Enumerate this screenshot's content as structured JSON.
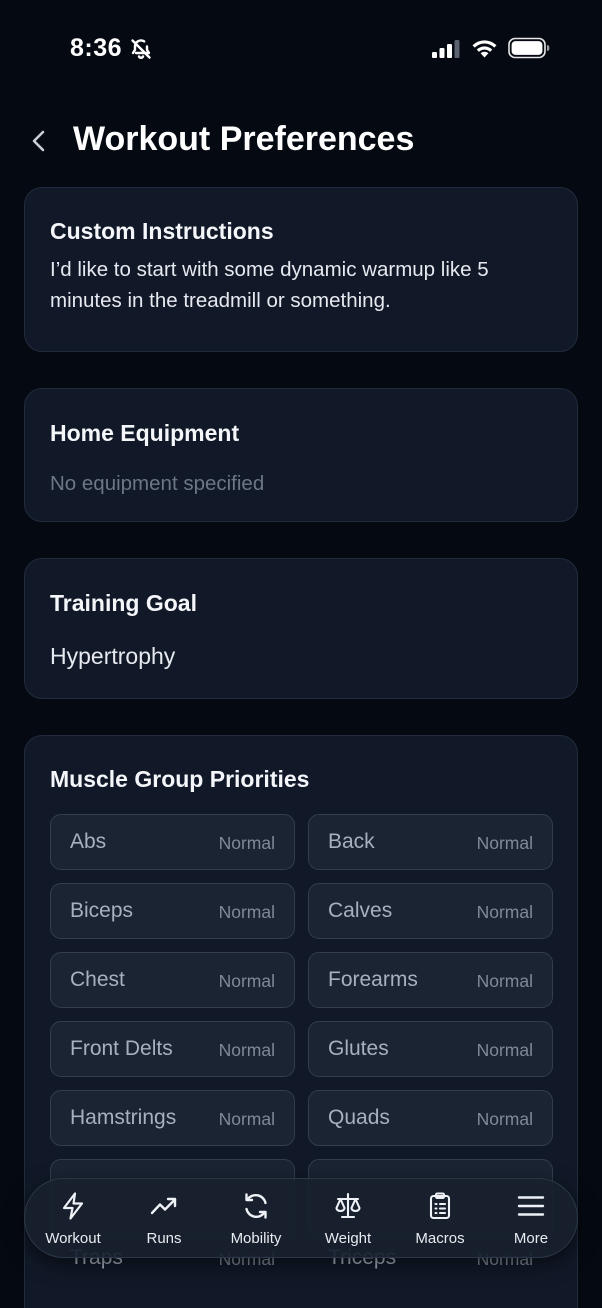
{
  "status_bar": {
    "time": "8:36",
    "icons": [
      "bell-slash-icon",
      "signal-icon",
      "wifi-icon",
      "battery-icon"
    ]
  },
  "header": {
    "back_icon": "chevron-left-icon",
    "title": "Workout Preferences"
  },
  "custom_instructions": {
    "title": "Custom Instructions",
    "text": "I’d like to start with some dynamic warmup like 5 minutes in the treadmill or something."
  },
  "home_equipment": {
    "title": "Home Equipment",
    "placeholder": "No equipment specified"
  },
  "training_goal": {
    "title": "Training Goal",
    "value": "Hypertrophy"
  },
  "muscle_priorities": {
    "title": "Muscle Group Priorities",
    "groups": [
      {
        "name": "Abs",
        "level": "Normal"
      },
      {
        "name": "Back",
        "level": "Normal"
      },
      {
        "name": "Biceps",
        "level": "Normal"
      },
      {
        "name": "Calves",
        "level": "Normal"
      },
      {
        "name": "Chest",
        "level": "Normal"
      },
      {
        "name": "Forearms",
        "level": "Normal"
      },
      {
        "name": "Front Delts",
        "level": "Normal"
      },
      {
        "name": "Glutes",
        "level": "Normal"
      },
      {
        "name": "Hamstrings",
        "level": "Normal"
      },
      {
        "name": "Quads",
        "level": "Normal"
      },
      {
        "name": "Traps",
        "level": "Normal"
      },
      {
        "name": "Triceps",
        "level": "Normal"
      }
    ]
  },
  "tab_bar": {
    "tabs": [
      {
        "label": "Workout",
        "icon": "lightning-icon"
      },
      {
        "label": "Runs",
        "icon": "trending-up-icon"
      },
      {
        "label": "Mobility",
        "icon": "refresh-icon"
      },
      {
        "label": "Weight",
        "icon": "scale-icon"
      },
      {
        "label": "Macros",
        "icon": "clipboard-list-icon"
      },
      {
        "label": "More",
        "icon": "menu-icon"
      }
    ]
  },
  "colors": {
    "background": "#050a12",
    "card": "#111928",
    "chip": "#1b2433",
    "text_primary": "#ffffff",
    "text_muted": "#6c7686"
  }
}
